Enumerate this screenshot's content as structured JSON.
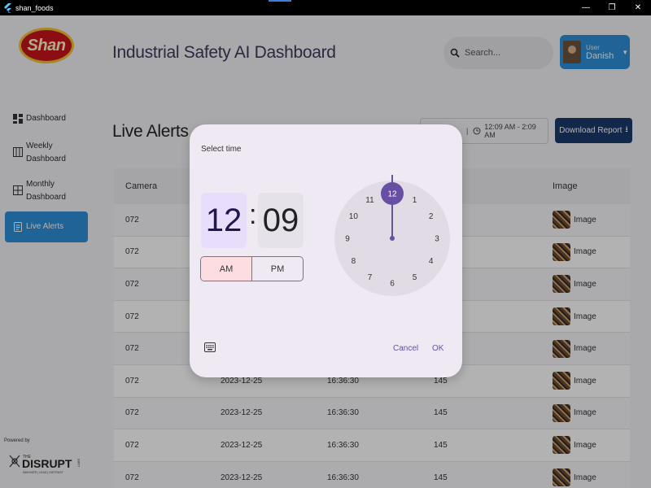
{
  "window": {
    "title": "shan_foods",
    "minimize": "—",
    "restore": "❐",
    "close": "✕"
  },
  "brand": {
    "logo_text": "Shan"
  },
  "header": {
    "title": "Industrial Safety AI Dashboard",
    "search_placeholder": "Search...",
    "user_role": "User",
    "user_name": "Danish"
  },
  "sidebar": {
    "items": [
      {
        "label": "Dashboard",
        "icon": "dashboard-icon"
      },
      {
        "label": "Weekly Dashboard",
        "icon": "calendar-week-icon"
      },
      {
        "label": "Monthly Dashboard",
        "icon": "grid-icon"
      },
      {
        "label": "Live Alerts",
        "icon": "alert-doc-icon",
        "active": true
      }
    ],
    "powered_by": "Powered by",
    "partner_name": "DISRUPT",
    "partner_prefix": "THE",
    "partner_suffix": "LABS",
    "partner_tagline": "INNOVATE | LEAD | DISTRUST"
  },
  "main": {
    "title": "Live Alerts",
    "date_range": "12:09 AM - 2:09 AM",
    "download_label": "Download Report",
    "table": {
      "headers": [
        "Camera",
        "",
        "",
        "e",
        "Image"
      ],
      "rows": [
        [
          "072",
          "",
          "",
          "",
          "Image"
        ],
        [
          "072",
          "",
          "",
          "",
          "Image"
        ],
        [
          "072",
          "",
          "",
          "",
          "Image"
        ],
        [
          "072",
          "",
          "",
          "",
          "Image"
        ],
        [
          "072",
          "",
          "",
          "",
          "Image"
        ],
        [
          "072",
          "2023-12-25",
          "16:36:30",
          "145",
          "Image"
        ],
        [
          "072",
          "2023-12-25",
          "16:36:30",
          "145",
          "Image"
        ],
        [
          "072",
          "2023-12-25",
          "16:36:30",
          "145",
          "Image"
        ],
        [
          "072",
          "2023-12-25",
          "16:36:30",
          "145",
          "Image"
        ]
      ]
    }
  },
  "time_picker": {
    "title": "Select time",
    "hour": "12",
    "minute": "09",
    "am": "AM",
    "pm": "PM",
    "selected_period": "AM",
    "dial_numbers": [
      "12",
      "1",
      "2",
      "3",
      "4",
      "5",
      "6",
      "7",
      "8",
      "9",
      "10",
      "11"
    ],
    "selected_hour": "12",
    "cancel": "Cancel",
    "ok": "OK",
    "colors": {
      "accent": "#6750a4",
      "hour_bg": "#e8ddfa",
      "am_bg": "#fddde2"
    }
  }
}
